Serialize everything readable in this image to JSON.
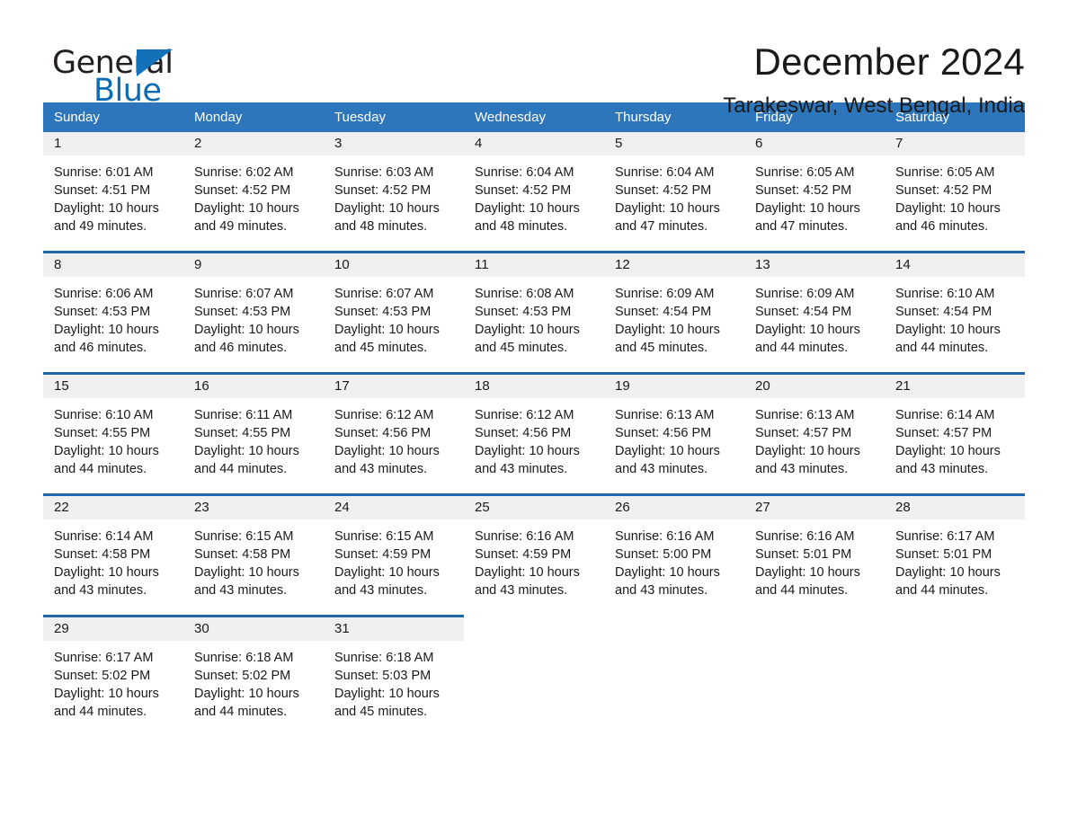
{
  "logo": {
    "word_general": "General",
    "word_blue": "Blue",
    "triangle_color": "#1271b8",
    "blue_text_color": "#0a6cb4"
  },
  "header": {
    "month_title": "December 2024",
    "location": "Tarakeswar, West Bengal, India"
  },
  "theme": {
    "header_blue": "#2e76bc",
    "rule_blue": "#1f66ab",
    "daynum_band": "#f0f0f0",
    "page_background": "#ffffff"
  },
  "weekdays": [
    "Sunday",
    "Monday",
    "Tuesday",
    "Wednesday",
    "Thursday",
    "Friday",
    "Saturday"
  ],
  "weeks": [
    [
      {
        "day": "1",
        "sunrise": "Sunrise: 6:01 AM",
        "sunset": "Sunset: 4:51 PM",
        "daylight_1": "Daylight: 10 hours",
        "daylight_2": "and 49 minutes."
      },
      {
        "day": "2",
        "sunrise": "Sunrise: 6:02 AM",
        "sunset": "Sunset: 4:52 PM",
        "daylight_1": "Daylight: 10 hours",
        "daylight_2": "and 49 minutes."
      },
      {
        "day": "3",
        "sunrise": "Sunrise: 6:03 AM",
        "sunset": "Sunset: 4:52 PM",
        "daylight_1": "Daylight: 10 hours",
        "daylight_2": "and 48 minutes."
      },
      {
        "day": "4",
        "sunrise": "Sunrise: 6:04 AM",
        "sunset": "Sunset: 4:52 PM",
        "daylight_1": "Daylight: 10 hours",
        "daylight_2": "and 48 minutes."
      },
      {
        "day": "5",
        "sunrise": "Sunrise: 6:04 AM",
        "sunset": "Sunset: 4:52 PM",
        "daylight_1": "Daylight: 10 hours",
        "daylight_2": "and 47 minutes."
      },
      {
        "day": "6",
        "sunrise": "Sunrise: 6:05 AM",
        "sunset": "Sunset: 4:52 PM",
        "daylight_1": "Daylight: 10 hours",
        "daylight_2": "and 47 minutes."
      },
      {
        "day": "7",
        "sunrise": "Sunrise: 6:05 AM",
        "sunset": "Sunset: 4:52 PM",
        "daylight_1": "Daylight: 10 hours",
        "daylight_2": "and 46 minutes."
      }
    ],
    [
      {
        "day": "8",
        "sunrise": "Sunrise: 6:06 AM",
        "sunset": "Sunset: 4:53 PM",
        "daylight_1": "Daylight: 10 hours",
        "daylight_2": "and 46 minutes."
      },
      {
        "day": "9",
        "sunrise": "Sunrise: 6:07 AM",
        "sunset": "Sunset: 4:53 PM",
        "daylight_1": "Daylight: 10 hours",
        "daylight_2": "and 46 minutes."
      },
      {
        "day": "10",
        "sunrise": "Sunrise: 6:07 AM",
        "sunset": "Sunset: 4:53 PM",
        "daylight_1": "Daylight: 10 hours",
        "daylight_2": "and 45 minutes."
      },
      {
        "day": "11",
        "sunrise": "Sunrise: 6:08 AM",
        "sunset": "Sunset: 4:53 PM",
        "daylight_1": "Daylight: 10 hours",
        "daylight_2": "and 45 minutes."
      },
      {
        "day": "12",
        "sunrise": "Sunrise: 6:09 AM",
        "sunset": "Sunset: 4:54 PM",
        "daylight_1": "Daylight: 10 hours",
        "daylight_2": "and 45 minutes."
      },
      {
        "day": "13",
        "sunrise": "Sunrise: 6:09 AM",
        "sunset": "Sunset: 4:54 PM",
        "daylight_1": "Daylight: 10 hours",
        "daylight_2": "and 44 minutes."
      },
      {
        "day": "14",
        "sunrise": "Sunrise: 6:10 AM",
        "sunset": "Sunset: 4:54 PM",
        "daylight_1": "Daylight: 10 hours",
        "daylight_2": "and 44 minutes."
      }
    ],
    [
      {
        "day": "15",
        "sunrise": "Sunrise: 6:10 AM",
        "sunset": "Sunset: 4:55 PM",
        "daylight_1": "Daylight: 10 hours",
        "daylight_2": "and 44 minutes."
      },
      {
        "day": "16",
        "sunrise": "Sunrise: 6:11 AM",
        "sunset": "Sunset: 4:55 PM",
        "daylight_1": "Daylight: 10 hours",
        "daylight_2": "and 44 minutes."
      },
      {
        "day": "17",
        "sunrise": "Sunrise: 6:12 AM",
        "sunset": "Sunset: 4:56 PM",
        "daylight_1": "Daylight: 10 hours",
        "daylight_2": "and 43 minutes."
      },
      {
        "day": "18",
        "sunrise": "Sunrise: 6:12 AM",
        "sunset": "Sunset: 4:56 PM",
        "daylight_1": "Daylight: 10 hours",
        "daylight_2": "and 43 minutes."
      },
      {
        "day": "19",
        "sunrise": "Sunrise: 6:13 AM",
        "sunset": "Sunset: 4:56 PM",
        "daylight_1": "Daylight: 10 hours",
        "daylight_2": "and 43 minutes."
      },
      {
        "day": "20",
        "sunrise": "Sunrise: 6:13 AM",
        "sunset": "Sunset: 4:57 PM",
        "daylight_1": "Daylight: 10 hours",
        "daylight_2": "and 43 minutes."
      },
      {
        "day": "21",
        "sunrise": "Sunrise: 6:14 AM",
        "sunset": "Sunset: 4:57 PM",
        "daylight_1": "Daylight: 10 hours",
        "daylight_2": "and 43 minutes."
      }
    ],
    [
      {
        "day": "22",
        "sunrise": "Sunrise: 6:14 AM",
        "sunset": "Sunset: 4:58 PM",
        "daylight_1": "Daylight: 10 hours",
        "daylight_2": "and 43 minutes."
      },
      {
        "day": "23",
        "sunrise": "Sunrise: 6:15 AM",
        "sunset": "Sunset: 4:58 PM",
        "daylight_1": "Daylight: 10 hours",
        "daylight_2": "and 43 minutes."
      },
      {
        "day": "24",
        "sunrise": "Sunrise: 6:15 AM",
        "sunset": "Sunset: 4:59 PM",
        "daylight_1": "Daylight: 10 hours",
        "daylight_2": "and 43 minutes."
      },
      {
        "day": "25",
        "sunrise": "Sunrise: 6:16 AM",
        "sunset": "Sunset: 4:59 PM",
        "daylight_1": "Daylight: 10 hours",
        "daylight_2": "and 43 minutes."
      },
      {
        "day": "26",
        "sunrise": "Sunrise: 6:16 AM",
        "sunset": "Sunset: 5:00 PM",
        "daylight_1": "Daylight: 10 hours",
        "daylight_2": "and 43 minutes."
      },
      {
        "day": "27",
        "sunrise": "Sunrise: 6:16 AM",
        "sunset": "Sunset: 5:01 PM",
        "daylight_1": "Daylight: 10 hours",
        "daylight_2": "and 44 minutes."
      },
      {
        "day": "28",
        "sunrise": "Sunrise: 6:17 AM",
        "sunset": "Sunset: 5:01 PM",
        "daylight_1": "Daylight: 10 hours",
        "daylight_2": "and 44 minutes."
      }
    ],
    [
      {
        "day": "29",
        "sunrise": "Sunrise: 6:17 AM",
        "sunset": "Sunset: 5:02 PM",
        "daylight_1": "Daylight: 10 hours",
        "daylight_2": "and 44 minutes."
      },
      {
        "day": "30",
        "sunrise": "Sunrise: 6:18 AM",
        "sunset": "Sunset: 5:02 PM",
        "daylight_1": "Daylight: 10 hours",
        "daylight_2": "and 44 minutes."
      },
      {
        "day": "31",
        "sunrise": "Sunrise: 6:18 AM",
        "sunset": "Sunset: 5:03 PM",
        "daylight_1": "Daylight: 10 hours",
        "daylight_2": "and 45 minutes."
      },
      {
        "day": "",
        "sunrise": "",
        "sunset": "",
        "daylight_1": "",
        "daylight_2": ""
      },
      {
        "day": "",
        "sunrise": "",
        "sunset": "",
        "daylight_1": "",
        "daylight_2": ""
      },
      {
        "day": "",
        "sunrise": "",
        "sunset": "",
        "daylight_1": "",
        "daylight_2": ""
      },
      {
        "day": "",
        "sunrise": "",
        "sunset": "",
        "daylight_1": "",
        "daylight_2": ""
      }
    ]
  ]
}
